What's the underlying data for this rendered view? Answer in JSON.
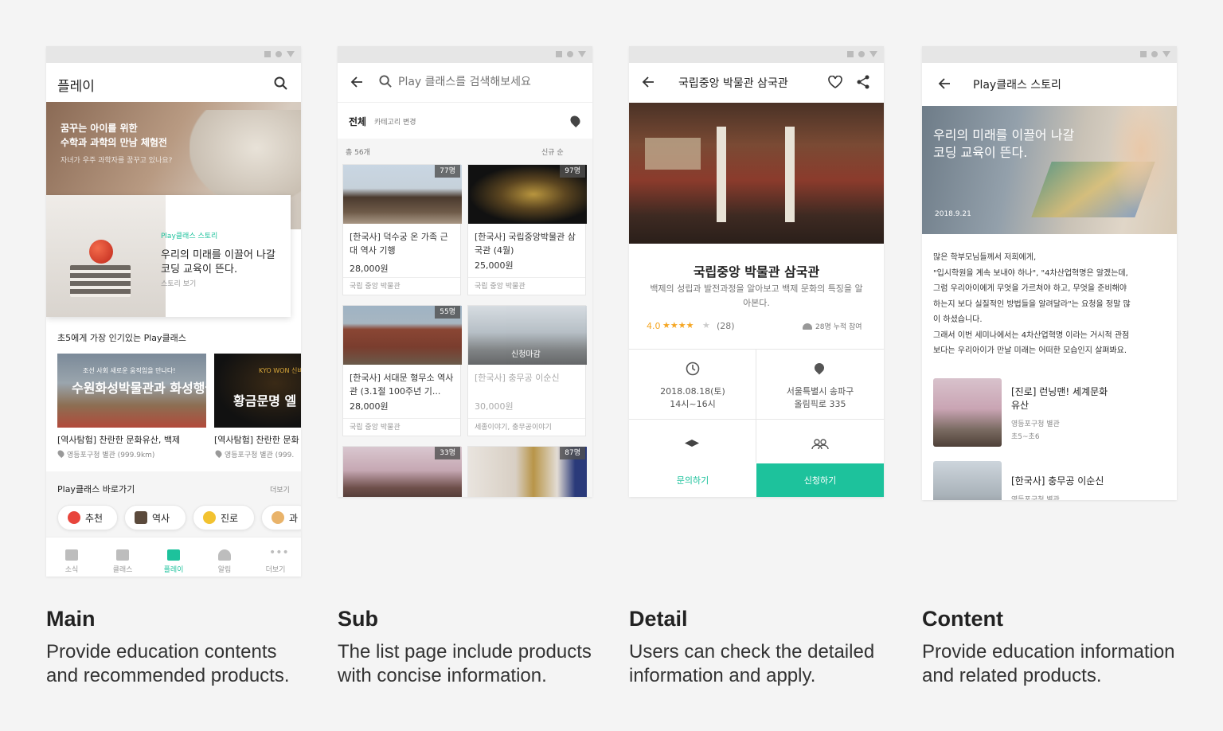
{
  "main": {
    "title": "플레이",
    "hero_line1": "꿈꾸는 아이를 위한",
    "hero_line2": "수학과 과학의 만남 체험전",
    "hero_sub": "자녀가 우주 과학자를 꿈꾸고 있나요?",
    "story_tag": "Play클래스 스토리",
    "story_line1": "우리의 미래를 이끌어 나갈",
    "story_line2": "코딩 교육이 뜬다.",
    "story_link": "스토리 보기",
    "popular_title": "초5에게 가장 인기있는 Play클래스",
    "popular": [
      {
        "thumb_small": "조선 사회 새로운 움직임을 만나다!",
        "thumb_big": "수원화성박물관과 화성행궁",
        "title": "[역사탐험] 찬란한 문화유산, 백제",
        "loc": "영등포구청 별관 (999.9km)"
      },
      {
        "thumb_small": "KYO WON 신비의 보물을 찾",
        "thumb_big": "황금문명 엘",
        "title": "[역사탐험] 찬란한 문화",
        "loc": "영등포구청 별관 (999."
      }
    ],
    "shortcut_title": "Play클래스 바로가기",
    "shortcut_more": "더보기",
    "chips": [
      "추천",
      "역사",
      "진로",
      "과"
    ],
    "nav": [
      "소식",
      "클래스",
      "플레이",
      "알림",
      "더보기"
    ]
  },
  "sub": {
    "search_placeholder": "Play 클래스를 검색해보세요",
    "all": "전체",
    "category_change": "카테고리 변경",
    "total": "총 56개",
    "sort": "신규 순",
    "cards": [
      {
        "badge": "77명",
        "title": "[한국사] 덕수궁 온 가족 근대 역사 기행",
        "price": "28,000원",
        "place": "국립 중앙 박물관"
      },
      {
        "badge": "97명",
        "title": "[한국사] 국립중앙박물관 삼국관 (4월)",
        "price": "25,000원",
        "place": "국립 중앙 박물관"
      },
      {
        "badge": "55명",
        "title": "[한국사] 서대문 형무소 역사관 (3.1절 100주년 기...",
        "price": "28,000원",
        "place": "국립 중앙 박물관"
      },
      {
        "badge": "",
        "overlay": "신청마감",
        "title": "[한국사] 충무공 이순신",
        "price": "30,000원",
        "place": "세종이야기, 충무공이야기"
      },
      {
        "badge": "33명",
        "title": "",
        "price": "",
        "place": ""
      },
      {
        "badge": "87명",
        "title": "",
        "price": "",
        "place": ""
      }
    ]
  },
  "detail": {
    "title": "국립중앙 박물관 삼국관",
    "heading": "국립중앙 박물관 삼국관",
    "desc": "백제의 성립과 발전과정을 알아보고 백제 문화의 특징을 알아본다.",
    "rating": "4.0",
    "stars": "★★★★",
    "star_off": "★",
    "reviews": "(28)",
    "participants": "28명 누적 참여",
    "date": "2018.08.18(토)",
    "time": "14시~16시",
    "addr1": "서울특별시 송파구",
    "addr2": "올림픽로 335",
    "inquiry": "문의하기",
    "apply": "신청하기"
  },
  "content": {
    "title": "Play클래스 스토리",
    "hero_line1": "우리의 미래를 이끌어 나갈",
    "hero_line2": "코딩 교육이 뜬다.",
    "hero_date": "2018.9.21",
    "body": [
      "많은 학부모님들께서 저희에게,",
      "\"입시학원을 계속 보내야 하나\", \"4차산업혁명은 알겠는데,",
      "그럼 우리아이에게 무엇을 가르쳐야 하고, 무엇을 준비해야",
      "하는지 보다 실질적인 방법들을 알려달라\"는 요청을 정말 많",
      "이 하셨습니다.",
      "그래서 이번 세미나에서는 4차산업혁명 이라는 거시적 관점",
      "보다는 우리아이가 만날 미래는 어떠한 모습인지 살펴봐요."
    ],
    "related": [
      {
        "title1": "[진로] 런닝맨! 세계문화",
        "title2": "유산",
        "place": "영등포구청 별관",
        "grade": "초5~초6"
      },
      {
        "title1": "[한국사] 충무공 이순신",
        "title2": "",
        "place": "영등포구청 별관",
        "grade": ""
      }
    ]
  },
  "captions": [
    {
      "title": "Main",
      "desc": "Provide education contents and recommended products."
    },
    {
      "title": "Sub",
      "desc": "The list page include products with concise information."
    },
    {
      "title": "Detail",
      "desc": "Users can check the detailed information and apply."
    },
    {
      "title": "Content",
      "desc": "Provide education information and related products."
    }
  ],
  "colors": {
    "accent": "#1dc29c",
    "rating": "#f5a623",
    "background": "#f4f4f4"
  }
}
